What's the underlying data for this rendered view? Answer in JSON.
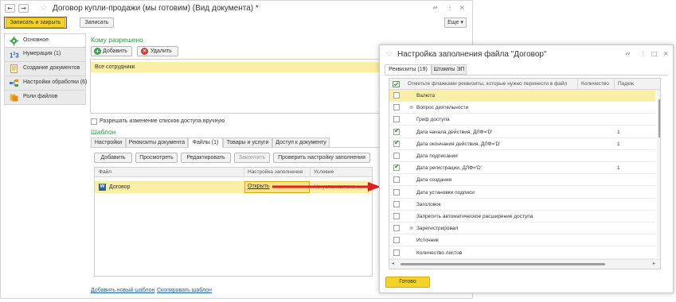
{
  "window": {
    "title": "Договор купли-продажи (мы готовим) (Вид документа) *",
    "back_glyph": "←",
    "forward_glyph": "→",
    "star_glyph": "☆",
    "link_glyph": "🔗",
    "menu_glyph": "⋮",
    "restore_glyph": "□",
    "close_glyph": "×"
  },
  "toolbar": {
    "save_close_label": "Записать и закрыть",
    "save_label": "Записать",
    "more_label": "Еще ▾"
  },
  "sidebar": {
    "items": [
      {
        "label": "Основное",
        "icon": "gear-icon"
      },
      {
        "label": "Нумерация (1)",
        "icon": "numbering-icon"
      },
      {
        "label": "Создание документов",
        "icon": "document-icon"
      },
      {
        "label": "Настройки обработки (6)",
        "icon": "processing-icon"
      },
      {
        "label": "Роли файлов",
        "icon": "file-roles-icon"
      }
    ]
  },
  "access": {
    "title": "Кому разрешено",
    "add_label": "Добавить",
    "delete_label": "Удалить",
    "rows": [
      "Все сотрудники"
    ],
    "allow_change_label": "Разрешать изменение списков доступа вручную"
  },
  "template": {
    "title": "Шаблон",
    "tabs": [
      "Настройки",
      "Реквизиты документа",
      "Файлы (1)",
      "Товары и услуги",
      "Доступ к документу"
    ],
    "active_tab": "Файлы (1)",
    "buttons": {
      "add": "Добавить",
      "view": "Просмотреть",
      "edit": "Редактировать",
      "finish": "Закончить",
      "check": "Проверить настройку заполнения"
    },
    "columns": [
      "Файл",
      "Настройка заполнения",
      "Условие"
    ],
    "rows": [
      {
        "file": "Договор",
        "fill": "Открыть",
        "condition": "Не установлено"
      }
    ],
    "add_new_link": "Добавить новый шаблон",
    "copy_link": "Скопировать шаблон"
  },
  "dialog": {
    "title": "Настройка заполнения файла \"Договор\"",
    "tabs": [
      "Реквизиты (19)",
      "Штампы ЭП"
    ],
    "active_tab": "Реквизиты (19)",
    "columns": [
      "Отметьте флажками реквизиты, которые нужно перенести в файл",
      "Количество",
      "Падеж"
    ],
    "rows": [
      {
        "name": "Валюта",
        "checked": false,
        "qty": "",
        "expandable": false,
        "selected": true
      },
      {
        "name": "Вопрос деятельности",
        "checked": false,
        "qty": "",
        "expandable": true,
        "selected": false
      },
      {
        "name": "Гриф доступа",
        "checked": false,
        "qty": "",
        "expandable": false,
        "selected": false
      },
      {
        "name": "Дата начала действия, ДЛФ='D'",
        "checked": true,
        "qty": "1",
        "expandable": false,
        "selected": false
      },
      {
        "name": "Дата окончания действия, ДЛФ='D'",
        "checked": true,
        "qty": "1",
        "expandable": false,
        "selected": false
      },
      {
        "name": "Дата подписания",
        "checked": false,
        "qty": "",
        "expandable": false,
        "selected": false
      },
      {
        "name": "Дата регистрации, ДЛФ='D'",
        "checked": true,
        "qty": "1",
        "expandable": false,
        "selected": false
      },
      {
        "name": "Дата создания",
        "checked": false,
        "qty": "",
        "expandable": false,
        "selected": false
      },
      {
        "name": "Дата установки подписи",
        "checked": false,
        "qty": "",
        "expandable": false,
        "selected": false
      },
      {
        "name": "Заголовок",
        "checked": false,
        "qty": "",
        "expandable": false,
        "selected": false
      },
      {
        "name": "Запретить автоматическое расширение доступа",
        "checked": false,
        "qty": "",
        "expandable": false,
        "selected": false
      },
      {
        "name": "Зарегистрировал",
        "checked": false,
        "qty": "",
        "expandable": true,
        "selected": false
      },
      {
        "name": "Источник",
        "checked": false,
        "qty": "",
        "expandable": false,
        "selected": false
      },
      {
        "name": "Количество листов",
        "checked": false,
        "qty": "",
        "expandable": false,
        "selected": false
      }
    ],
    "done_label": "Готово"
  },
  "colors": {
    "accent_yellow": "#f5d22a",
    "selected_row": "#fbeea6",
    "section_green": "#2e9a3e",
    "link_blue": "#1c5fa7",
    "arrow_red": "#e02020"
  }
}
